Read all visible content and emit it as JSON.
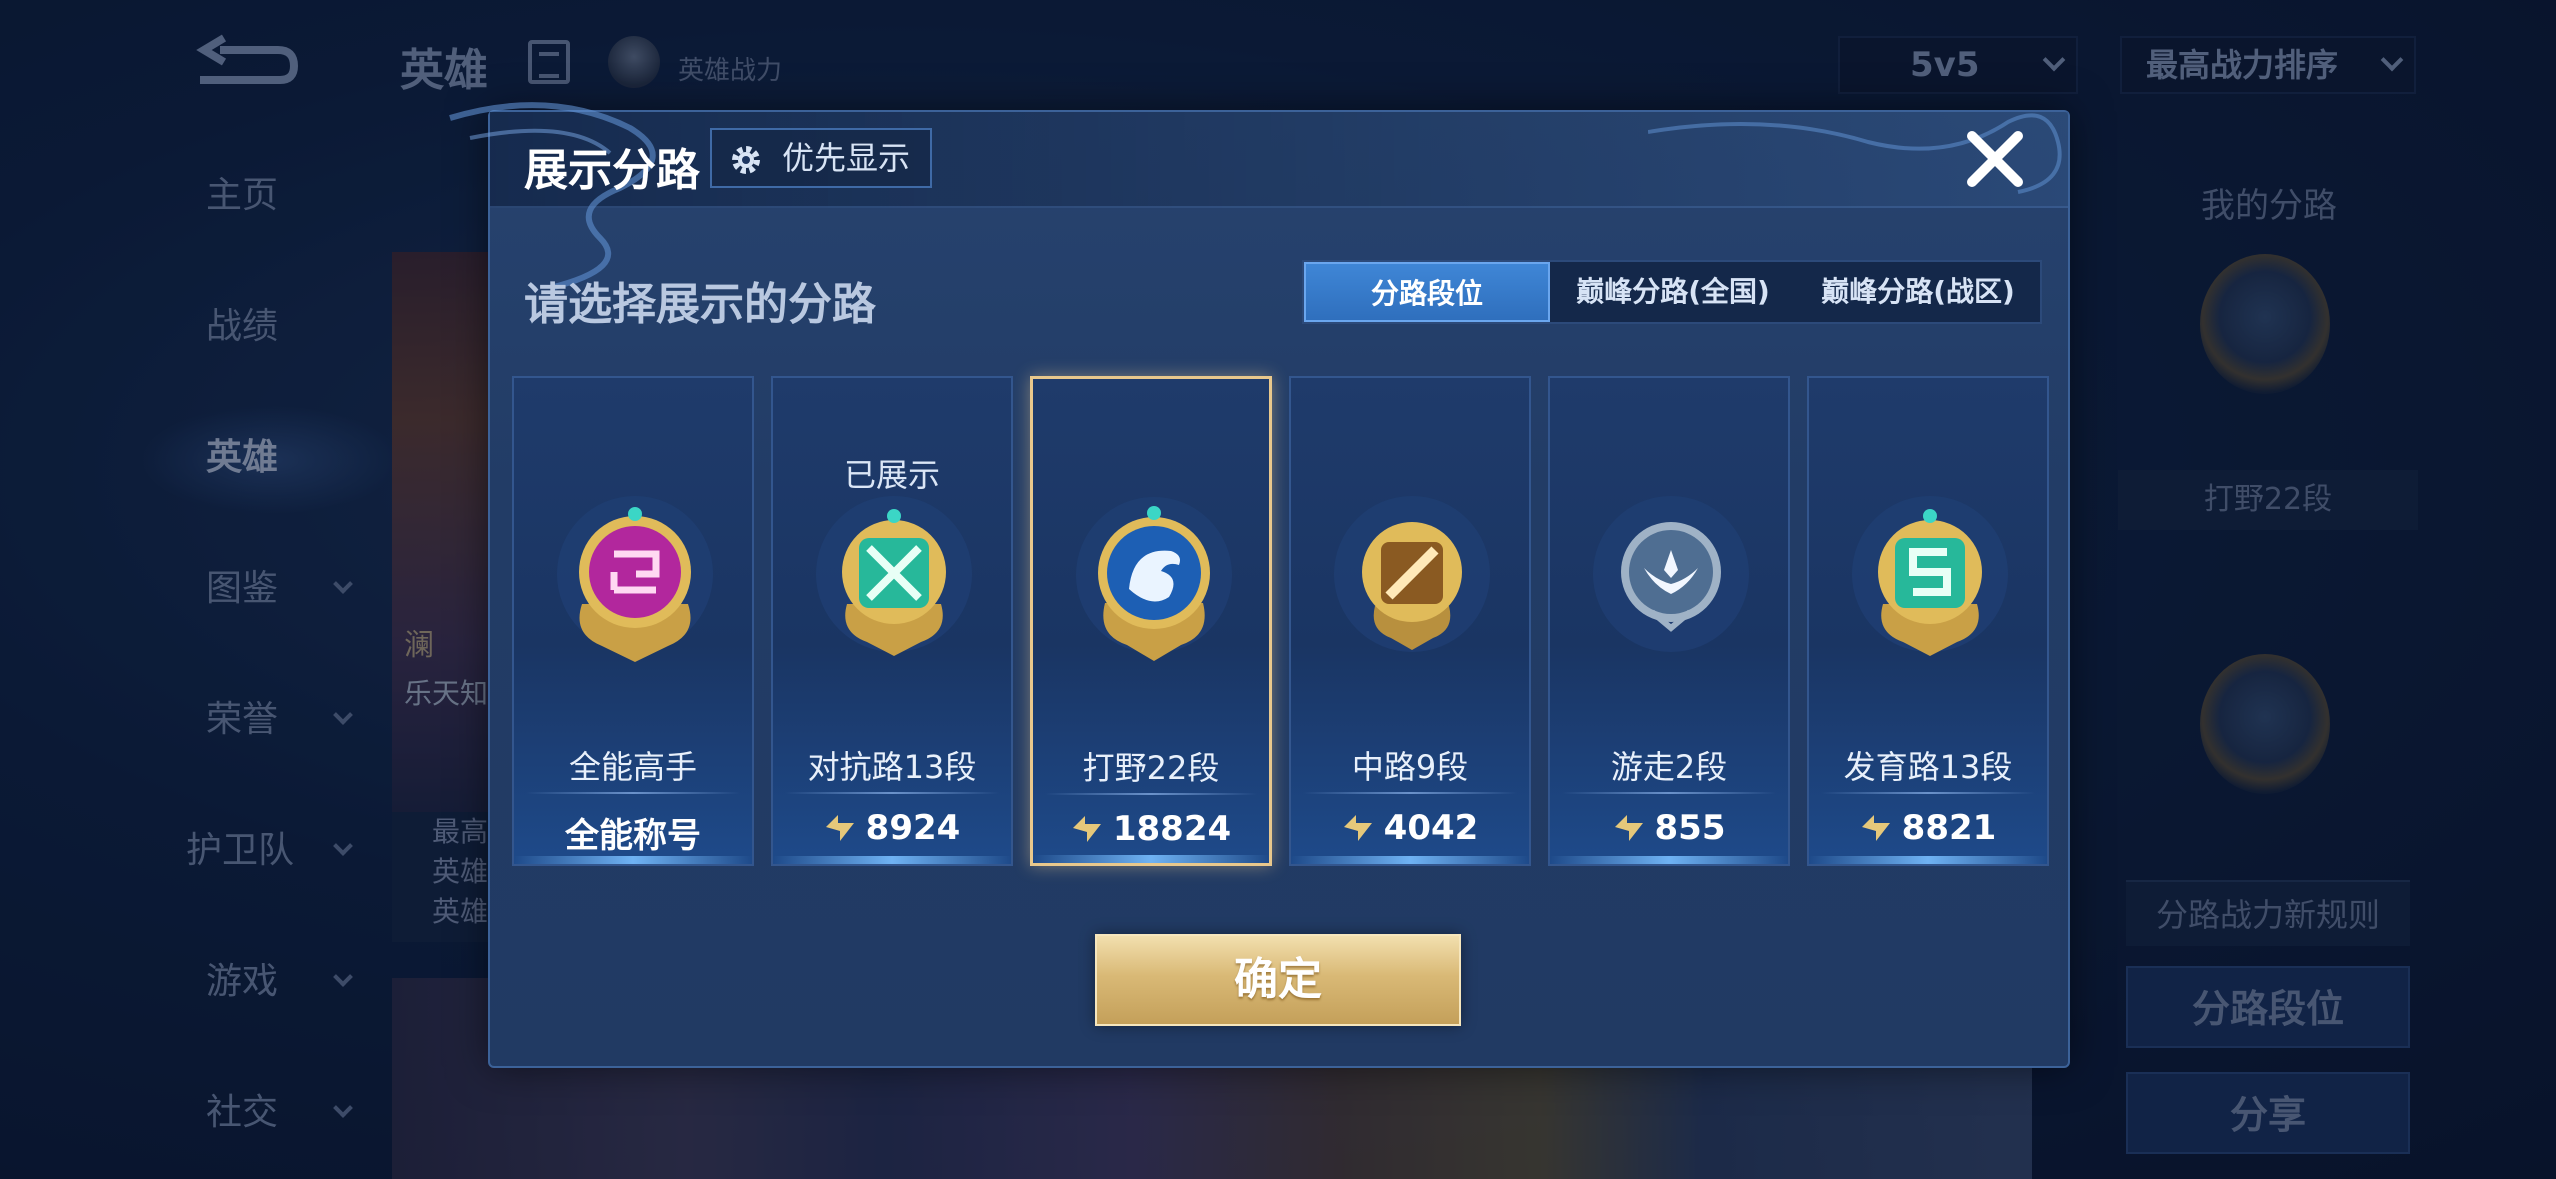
{
  "app": {
    "title": "英雄",
    "subtitle": "英雄战力",
    "mode_select": "5v5",
    "sort_select": "最高战力排序"
  },
  "sidebar": {
    "items": [
      {
        "label": "主页"
      },
      {
        "label": "战绩"
      },
      {
        "label": "英雄",
        "active": true
      },
      {
        "label": "图鉴"
      },
      {
        "label": "荣誉"
      },
      {
        "label": "护卫队"
      },
      {
        "label": "游戏"
      },
      {
        "label": "社交"
      }
    ]
  },
  "hero_card": {
    "name": "澜",
    "tag": "乐天知",
    "stats": [
      "最高",
      "英雄",
      "英雄"
    ]
  },
  "right_panel": {
    "title": "我的分路",
    "caption": "打野22段",
    "rule": "分路战力新规则",
    "lane_rank_button": "分路段位",
    "share_button": "分享"
  },
  "modal": {
    "title": "展示分路",
    "priority_button": "优先显示",
    "instruction": "请选择展示的分路",
    "tabs": [
      {
        "label": "分路段位",
        "selected": true
      },
      {
        "label": "巅峰分路(全国)",
        "selected": false
      },
      {
        "label": "巅峰分路(战区)",
        "selected": false
      }
    ],
    "cards": [
      {
        "name": "全能高手",
        "value": "全能称号",
        "shown": "",
        "has_icon": false,
        "selected": false,
        "emblem": "purple-emblem-icon"
      },
      {
        "name": "对抗路13段",
        "value": "8924",
        "shown": "已展示",
        "has_icon": true,
        "selected": false,
        "emblem": "teal-emblem-icon"
      },
      {
        "name": "打野22段",
        "value": "18824",
        "shown": "",
        "has_icon": true,
        "selected": true,
        "emblem": "dragon-emblem-icon"
      },
      {
        "name": "中路9段",
        "value": "4042",
        "shown": "",
        "has_icon": true,
        "selected": false,
        "emblem": "gold-emblem-icon"
      },
      {
        "name": "游走2段",
        "value": "855",
        "shown": "",
        "has_icon": true,
        "selected": false,
        "emblem": "wing-emblem-icon"
      },
      {
        "name": "发育路13段",
        "value": "8821",
        "shown": "",
        "has_icon": true,
        "selected": false,
        "emblem": "teal-s-emblem-icon"
      }
    ],
    "confirm_button": "确定"
  },
  "colors": {
    "accent_blue": "#2f6fbd",
    "gold_border": "#e9c88c",
    "confirm_gold": "#d9b976"
  }
}
